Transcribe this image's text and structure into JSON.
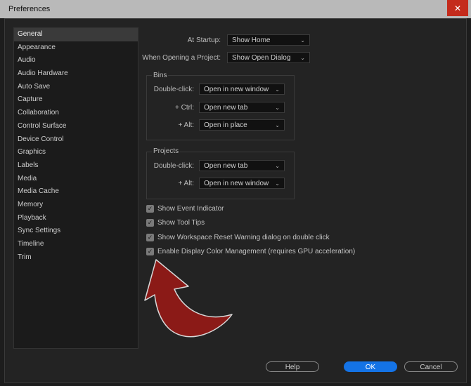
{
  "window": {
    "title": "Preferences",
    "close_glyph": "✕"
  },
  "sidebar": {
    "items": [
      {
        "label": "General",
        "selected": true
      },
      {
        "label": "Appearance"
      },
      {
        "label": "Audio"
      },
      {
        "label": "Audio Hardware"
      },
      {
        "label": "Auto Save"
      },
      {
        "label": "Capture"
      },
      {
        "label": "Collaboration"
      },
      {
        "label": "Control Surface"
      },
      {
        "label": "Device Control"
      },
      {
        "label": "Graphics"
      },
      {
        "label": "Labels"
      },
      {
        "label": "Media"
      },
      {
        "label": "Media Cache"
      },
      {
        "label": "Memory"
      },
      {
        "label": "Playback"
      },
      {
        "label": "Sync Settings"
      },
      {
        "label": "Timeline"
      },
      {
        "label": "Trim"
      }
    ]
  },
  "general": {
    "at_startup_label": "At Startup:",
    "at_startup_value": "Show Home",
    "opening_project_label": "When Opening a Project:",
    "opening_project_value": "Show Open Dialog",
    "bins": {
      "title": "Bins",
      "double_click_label": "Double-click:",
      "double_click_value": "Open in new window",
      "ctrl_label": "+ Ctrl:",
      "ctrl_value": "Open new tab",
      "alt_label": "+ Alt:",
      "alt_value": "Open in place"
    },
    "projects": {
      "title": "Projects",
      "double_click_label": "Double-click:",
      "double_click_value": "Open new tab",
      "alt_label": "+ Alt:",
      "alt_value": "Open in new window"
    },
    "checkboxes": [
      {
        "label": "Show Event Indicator",
        "checked": true
      },
      {
        "label": "Show Tool Tips",
        "checked": true
      },
      {
        "label": "Show Workspace Reset Warning dialog on double click",
        "checked": true
      },
      {
        "label": "Enable Display Color Management (requires GPU acceleration)",
        "checked": true
      }
    ],
    "check_glyph": "✓",
    "caret_glyph": "⌄"
  },
  "buttons": {
    "help": "Help",
    "ok": "OK",
    "cancel": "Cancel"
  },
  "colors": {
    "accent": "#1473e6",
    "close": "#c42b1c",
    "annotation_arrow": "#8b1a17"
  }
}
